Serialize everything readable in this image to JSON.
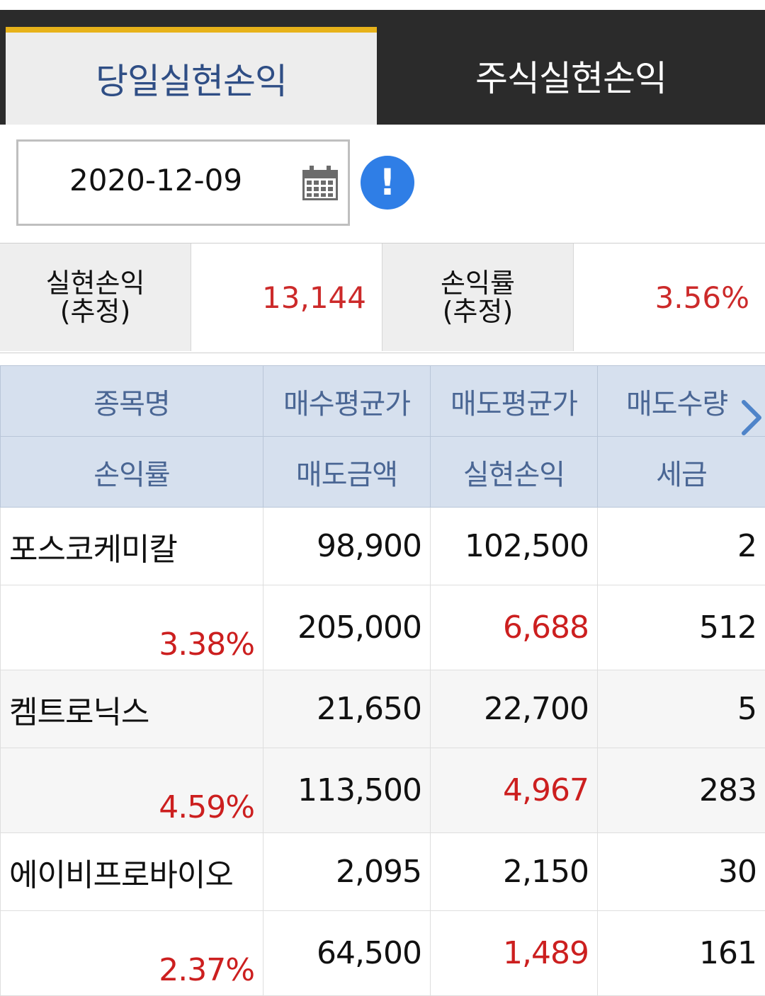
{
  "tabs": {
    "active_label": "당일실현손익",
    "inactive_label": "주식실현손익"
  },
  "date_filter": {
    "value": "2020-12-09"
  },
  "summary": {
    "realized_label_line1": "실현손익",
    "realized_label_line2": "(추정)",
    "realized_value": "13,144",
    "rate_label_line1": "손익률",
    "rate_label_line2": "(추정)",
    "rate_value": "3.56%"
  },
  "table": {
    "header_row1": [
      "종목명",
      "매수평균가",
      "매도평균가",
      "매도수량"
    ],
    "header_row2": [
      "손익률",
      "매도금액",
      "실현손익",
      "세금"
    ],
    "rows": [
      {
        "name": "포스코케미칼",
        "buy_avg": "98,900",
        "sell_avg": "102,500",
        "sell_qty": "2",
        "rate": "3.38%",
        "sell_amount": "205,000",
        "realized": "6,688",
        "tax": "512"
      },
      {
        "name": "켐트로닉스",
        "buy_avg": "21,650",
        "sell_avg": "22,700",
        "sell_qty": "5",
        "rate": "4.59%",
        "sell_amount": "113,500",
        "realized": "4,967",
        "tax": "283"
      },
      {
        "name": "에이비프로바이오",
        "buy_avg": "2,095",
        "sell_avg": "2,150",
        "sell_qty": "30",
        "rate": "2.37%",
        "sell_amount": "64,500",
        "realized": "1,489",
        "tax": "161"
      }
    ]
  },
  "icons": {
    "calendar": "calendar-icon",
    "info": "info-icon",
    "scroll_right": "chevron-right-icon"
  },
  "colors": {
    "tab_accent": "#e7b21a",
    "profit_red": "#cc1f1f",
    "header_blue": "#d6e0ee",
    "info_blue": "#2f7ee6"
  }
}
